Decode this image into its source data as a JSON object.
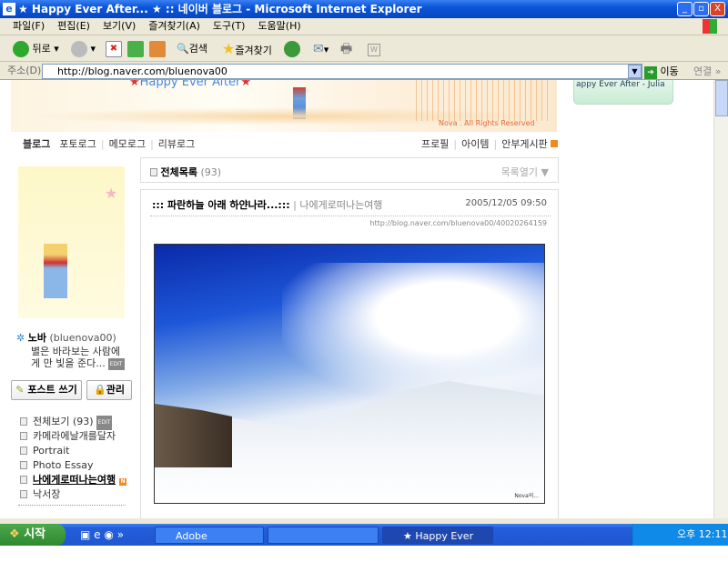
{
  "window": {
    "title": "★ Happy Ever After... ★ :: 네이버 블로그 - Microsoft Internet Explorer"
  },
  "menu": [
    "파일(F)",
    "편집(E)",
    "보기(V)",
    "즐겨찾기(A)",
    "도구(T)",
    "도움말(H)"
  ],
  "toolbar": {
    "back": "뒤로",
    "search": "검색",
    "favorites": "즐겨찾기"
  },
  "address": {
    "label": "주소(D)",
    "url": "http://blog.naver.com/bluenova00",
    "go": "이동",
    "links": "연결"
  },
  "banner": {
    "title": "Happy Ever After",
    "copyright": "Nova . All Rights Reserved"
  },
  "widget": {
    "text": "appy Ever After - Julia"
  },
  "nav": {
    "left": [
      "블로그",
      "포토로그",
      "메모로그",
      "리뷰로그"
    ],
    "right": [
      "프로필",
      "아이템",
      "안부게시판"
    ]
  },
  "profile": {
    "name": "노바",
    "id": "(bluenova00)",
    "desc": "별은 바라보는 사람에게 만 빛을 준다...",
    "edit": "EDIT"
  },
  "buttons": {
    "post": "포스트 쓰기",
    "manage": "관리"
  },
  "categories": [
    {
      "label": "전체보기",
      "count": "(93)",
      "badge": "EDIT"
    },
    {
      "label": "카메라에날개를달자"
    },
    {
      "label": "Portrait"
    },
    {
      "label": "Photo Essay"
    },
    {
      "label": "나에게로떠나는여행",
      "active": true,
      "badge": "N"
    },
    {
      "label": "낙서장"
    }
  ],
  "list": {
    "title": "전체목록",
    "count": "(93)",
    "toggle": "목록열기 ▼"
  },
  "post": {
    "title": "::: 파란하늘 아래 하얀나라...:::",
    "category": "나에게로떠나는여행",
    "date": "2005/12/05 09:50",
    "url": "http://blog.naver.com/bluenova00/40020264159",
    "watermark": "Nova의..."
  },
  "taskbar": {
    "start": "시작",
    "tasks": [
      "Adobe Photoshop",
      "",
      "★ Happy Ever Aft..."
    ],
    "clock": "오후 12:11"
  }
}
